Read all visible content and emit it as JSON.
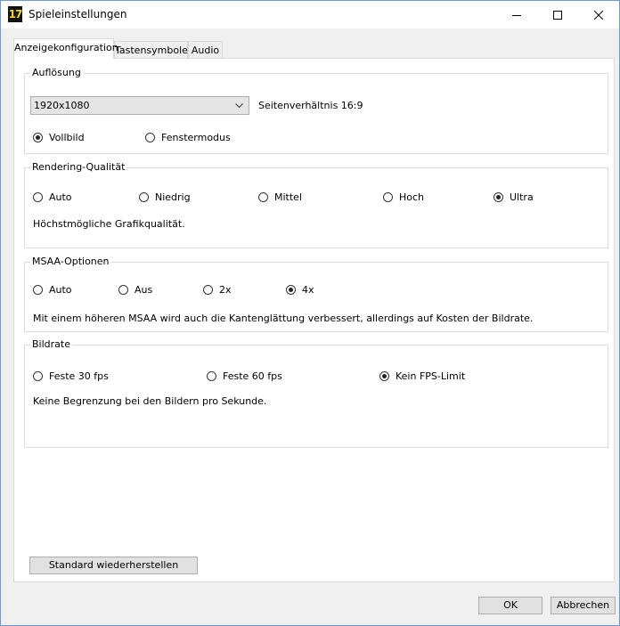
{
  "window": {
    "title": "Spieleinstellungen",
    "icon_text": "17",
    "icon_name": "app-logo-icon"
  },
  "tabs": [
    {
      "label": "Anzeigekonfiguration"
    },
    {
      "label": "Tastensymbole"
    },
    {
      "label": "Audio"
    }
  ],
  "resolution": {
    "group_label": "Auflösung",
    "selected": "1920x1080",
    "aspect_ratio": "Seitenverhältnis 16:9",
    "modes": [
      {
        "label": "Vollbild",
        "checked": true
      },
      {
        "label": "Fenstermodus",
        "checked": false
      }
    ]
  },
  "rendering": {
    "group_label": "Rendering-Qualität",
    "options": [
      {
        "label": "Auto",
        "checked": false
      },
      {
        "label": "Niedrig",
        "checked": false
      },
      {
        "label": "Mittel",
        "checked": false
      },
      {
        "label": "Hoch",
        "checked": false
      },
      {
        "label": "Ultra",
        "checked": true
      }
    ],
    "description": "Höchstmögliche Grafikqualität."
  },
  "msaa": {
    "group_label": "MSAA-Optionen",
    "options": [
      {
        "label": "Auto",
        "checked": false
      },
      {
        "label": "Aus",
        "checked": false
      },
      {
        "label": "2x",
        "checked": false
      },
      {
        "label": "4x",
        "checked": true
      }
    ],
    "description": "Mit einem höheren MSAA wird auch die Kantenglättung verbessert, allerdings auf Kosten der Bildrate."
  },
  "framerate": {
    "group_label": "Bildrate",
    "options": [
      {
        "label": "Feste 30 fps",
        "checked": false
      },
      {
        "label": "Feste 60 fps",
        "checked": false
      },
      {
        "label": "Kein FPS-Limit",
        "checked": true
      }
    ],
    "description": "Keine Begrenzung bei den Bildern pro Sekunde."
  },
  "buttons": {
    "restore_defaults": "Standard wiederherstellen",
    "ok": "OK",
    "cancel": "Abbrechen"
  }
}
